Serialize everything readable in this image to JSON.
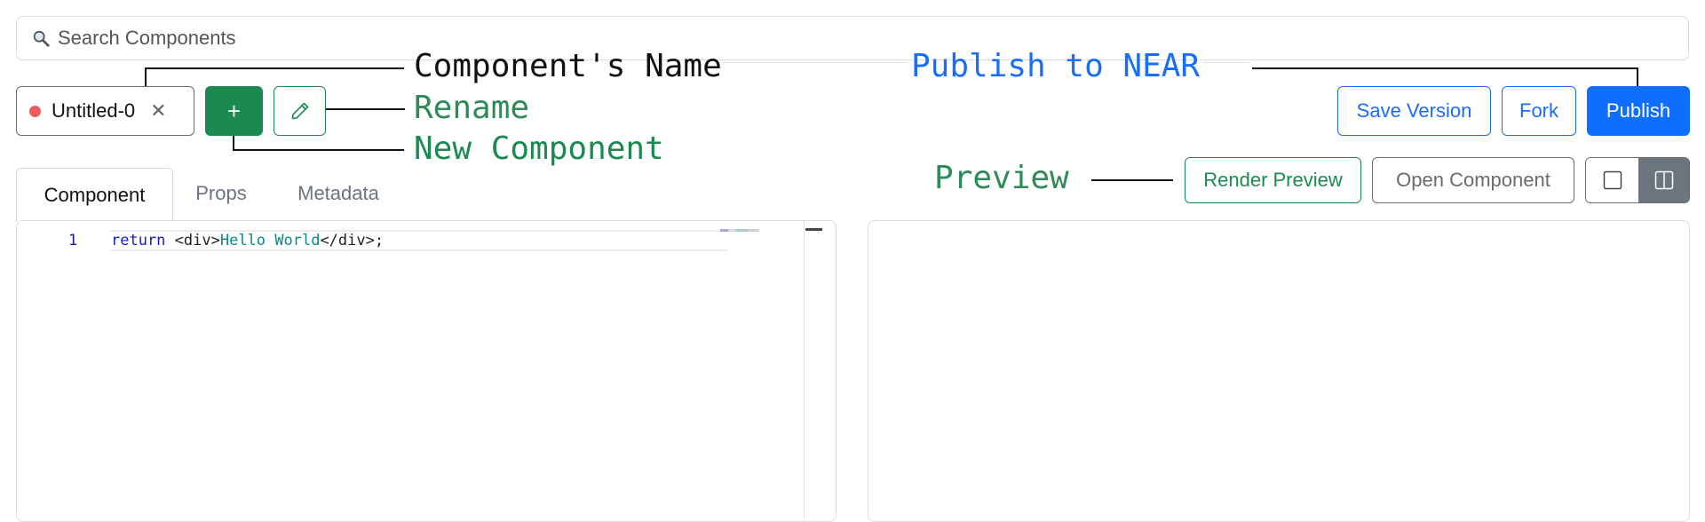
{
  "search": {
    "placeholder": "Search Components"
  },
  "file_tab": {
    "name": "Untitled-0",
    "close_glyph": "✕",
    "status_color": "#ef5a5a"
  },
  "toolbar": {
    "new_label": "+",
    "save_version_label": "Save Version",
    "fork_label": "Fork",
    "publish_label": "Publish"
  },
  "preview_bar": {
    "render_preview_label": "Render Preview",
    "open_component_label": "Open Component"
  },
  "annotations": {
    "component_name": "Component's Name",
    "rename": "Rename",
    "new_component": "New Component",
    "publish_to_near": "Publish to NEAR",
    "preview": "Preview"
  },
  "tabs": [
    {
      "label": "Component",
      "active": true
    },
    {
      "label": "Props",
      "active": false
    },
    {
      "label": "Metadata",
      "active": false
    }
  ],
  "editor": {
    "line_number": "1",
    "code": {
      "keyword": "return",
      "open_tag": " <div>",
      "text": "Hello World",
      "close_tag": "</div>;"
    }
  },
  "colors": {
    "primary_blue": "#0f6efd",
    "success_green": "#1a8a50",
    "annotation_blue": "#1a6ef5",
    "annotation_green": "#2e8b57"
  },
  "icons": [
    "search-icon",
    "close-icon",
    "plus-icon",
    "pencil-icon",
    "single-pane-icon",
    "split-pane-icon"
  ]
}
